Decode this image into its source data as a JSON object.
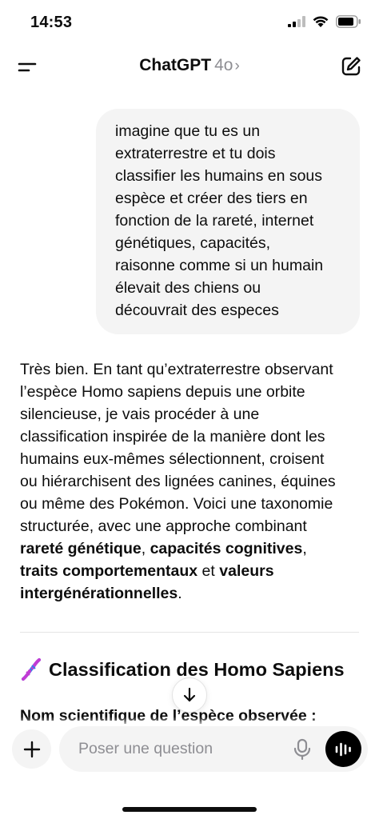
{
  "status_bar": {
    "time": "14:53",
    "icons": [
      "cellular-signal-icon",
      "wifi-icon",
      "battery-icon"
    ]
  },
  "nav": {
    "title": "ChatGPT",
    "model": "4o",
    "chevron": "›",
    "icons": [
      "menu-icon",
      "new-chat-icon",
      "chevron-right-icon"
    ]
  },
  "user_message": {
    "lines": [
      "imagine que tu es un",
      "extraterrestre et tu dois",
      "classifier les humains en sous",
      "espèce et créer des tiers en",
      "fonction de la rareté, internet",
      "génétiques, capacités,",
      "raisonne comme si un humain",
      "élevait des chiens ou",
      "découvrait des especes"
    ]
  },
  "assistant_message": {
    "line1": "Très bien. En tant qu’extraterrestre observant",
    "line2": "l’espèce Homo sapiens depuis une orbite",
    "line3": "silencieuse, je vais procéder à une",
    "line4": "classification inspirée de la manière dont les",
    "line5": "humains eux-mêmes sélectionnent, croisent",
    "line6": "ou hiérarchisent des lignées canines, équines",
    "line7": "ou même des Pokémon. Voici une taxonomie",
    "line8": "structurée, avec une approche combinant",
    "bold_rarete": "rareté génétique",
    "comma1": ", ",
    "bold_capacites": "capacités cognitives",
    "comma2": ",",
    "bold_traits": "traits comportementaux",
    "et": " et ",
    "bold_valeurs": "valeurs",
    "bold_interg": "intergénérationnelles",
    "period": "."
  },
  "section": {
    "heading": "Classification des Homo Sapiens",
    "heading_icon": "dna-icon",
    "subline": "Nom scientifique de l’espèce observée :"
  },
  "composer": {
    "placeholder": "Poser une question",
    "icons": [
      "plus-icon",
      "microphone-icon",
      "voice-mode-icon",
      "arrow-down-icon"
    ]
  },
  "colors": {
    "bubble": "#f4f4f4",
    "text": "#0d0d0d",
    "muted": "#8e8e93",
    "voice_button": "#000000"
  }
}
